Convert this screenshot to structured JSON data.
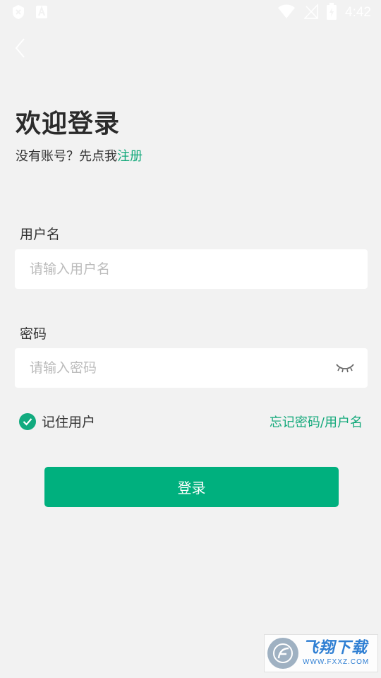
{
  "status_bar": {
    "time": "4:42",
    "icons": [
      "notification-x-icon",
      "notification-a-icon",
      "wifi-icon",
      "signal-off-icon",
      "battery-icon"
    ]
  },
  "nav": {
    "back_icon": "chevron-left-icon"
  },
  "header": {
    "title": "欢迎登录",
    "subtitle_prefix": "没有账号？先点我",
    "register_link": "注册"
  },
  "form": {
    "username": {
      "label": "用户名",
      "placeholder": "请输入用户名",
      "value": ""
    },
    "password": {
      "label": "密码",
      "placeholder": "请输入密码",
      "value": "",
      "toggle_icon": "eye-closed-icon"
    },
    "remember": {
      "label": "记住用户",
      "checked": true
    },
    "forgot_link": "忘记密码/用户名",
    "submit_label": "登录"
  },
  "watermark": {
    "cn": "飞翔下载",
    "en": "WWW.FXXZ.COM"
  },
  "colors": {
    "accent": "#00b07e",
    "link": "#14a97b",
    "background": "#f2f2f2"
  }
}
